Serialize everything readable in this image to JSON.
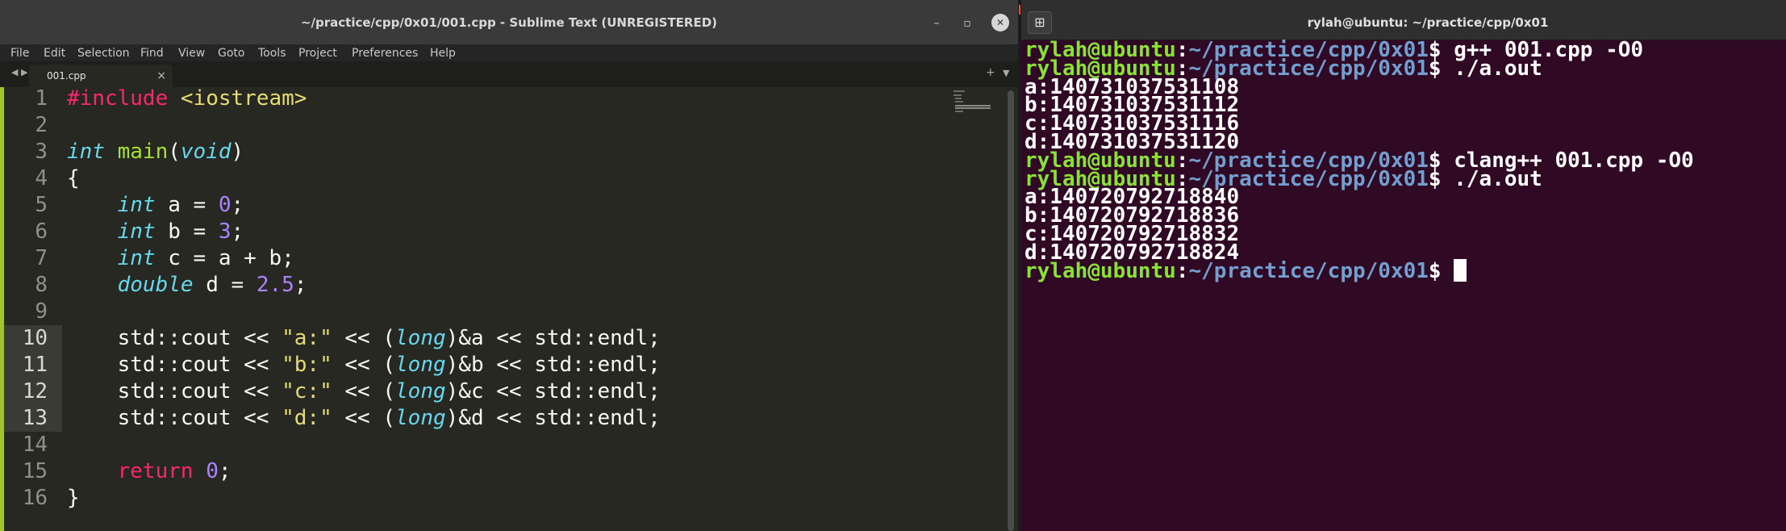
{
  "sublime": {
    "title": "~/practice/cpp/0x01/001.cpp - Sublime Text (UNREGISTERED)",
    "window_buttons": {
      "minimize": "–",
      "maximize": "▫",
      "close": "✕"
    },
    "menu": [
      "File",
      "Edit",
      "Selection",
      "Find",
      "View",
      "Goto",
      "Tools",
      "Project",
      "Preferences",
      "Help"
    ],
    "tab": {
      "label": "001.cpp",
      "close": "×"
    },
    "tab_nav": {
      "left": "◀",
      "right": "▶",
      "add": "+",
      "dropdown": "▼"
    },
    "lines": [
      {
        "n": "1",
        "tokens": [
          [
            "pre",
            "#include"
          ],
          [
            "txt",
            " "
          ],
          [
            "inc",
            "<iostream>"
          ]
        ]
      },
      {
        "n": "2",
        "tokens": []
      },
      {
        "n": "3",
        "tokens": [
          [
            "type",
            "int"
          ],
          [
            "txt",
            " "
          ],
          [
            "fn",
            "main"
          ],
          [
            "txt",
            "("
          ],
          [
            "type",
            "void"
          ],
          [
            "txt",
            ")"
          ]
        ]
      },
      {
        "n": "4",
        "tokens": [
          [
            "txt",
            "{"
          ]
        ]
      },
      {
        "n": "5",
        "tokens": [
          [
            "txt",
            "    "
          ],
          [
            "type",
            "int"
          ],
          [
            "txt",
            " a = "
          ],
          [
            "num",
            "0"
          ],
          [
            "txt",
            ";"
          ]
        ]
      },
      {
        "n": "6",
        "tokens": [
          [
            "txt",
            "    "
          ],
          [
            "type",
            "int"
          ],
          [
            "txt",
            " b = "
          ],
          [
            "num",
            "3"
          ],
          [
            "txt",
            ";"
          ]
        ]
      },
      {
        "n": "7",
        "tokens": [
          [
            "txt",
            "    "
          ],
          [
            "type",
            "int"
          ],
          [
            "txt",
            " c = a + b;"
          ]
        ]
      },
      {
        "n": "8",
        "tokens": [
          [
            "txt",
            "    "
          ],
          [
            "type",
            "double"
          ],
          [
            "txt",
            " d = "
          ],
          [
            "num",
            "2.5"
          ],
          [
            "txt",
            ";"
          ]
        ]
      },
      {
        "n": "9",
        "tokens": []
      },
      {
        "n": "10",
        "tokens": [
          [
            "txt",
            "    std::cout << "
          ],
          [
            "str",
            "\"a:\""
          ],
          [
            "txt",
            " << ("
          ],
          [
            "type",
            "long"
          ],
          [
            "txt",
            ")&a << std::endl;"
          ]
        ],
        "selected": true
      },
      {
        "n": "11",
        "tokens": [
          [
            "txt",
            "    std::cout << "
          ],
          [
            "str",
            "\"b:\""
          ],
          [
            "txt",
            " << ("
          ],
          [
            "type",
            "long"
          ],
          [
            "txt",
            ")&b << std::endl;"
          ]
        ],
        "selected": true
      },
      {
        "n": "12",
        "tokens": [
          [
            "txt",
            "    std::cout << "
          ],
          [
            "str",
            "\"c:\""
          ],
          [
            "txt",
            " << ("
          ],
          [
            "type",
            "long"
          ],
          [
            "txt",
            ")&c << std::endl;"
          ]
        ],
        "selected": true
      },
      {
        "n": "13",
        "tokens": [
          [
            "txt",
            "    std::cout << "
          ],
          [
            "str",
            "\"d:\""
          ],
          [
            "txt",
            " << ("
          ],
          [
            "type",
            "long"
          ],
          [
            "txt",
            ")&d << std::endl;"
          ]
        ],
        "selected": true
      },
      {
        "n": "14",
        "tokens": []
      },
      {
        "n": "15",
        "tokens": [
          [
            "txt",
            "    "
          ],
          [
            "ret",
            "return"
          ],
          [
            "txt",
            " "
          ],
          [
            "num",
            "0"
          ],
          [
            "txt",
            ";"
          ]
        ]
      },
      {
        "n": "16",
        "tokens": [
          [
            "txt",
            "}"
          ]
        ]
      }
    ]
  },
  "terminal": {
    "title": "rylah@ubuntu: ~/practice/cpp/0x01",
    "new_tab_icon": "⊞",
    "prompt_user": "rylah@ubuntu",
    "prompt_sep": ":",
    "prompt_path": "~/practice/cpp/0x01",
    "prompt_end": "$ ",
    "lines": [
      {
        "kind": "prompt",
        "cmd": "g++ 001.cpp -O0"
      },
      {
        "kind": "prompt",
        "cmd": "./a.out"
      },
      {
        "kind": "out",
        "text": "a:140731037531108"
      },
      {
        "kind": "out",
        "text": "b:140731037531112"
      },
      {
        "kind": "out",
        "text": "c:140731037531116"
      },
      {
        "kind": "out",
        "text": "d:140731037531120"
      },
      {
        "kind": "prompt",
        "cmd": "clang++ 001.cpp -O0"
      },
      {
        "kind": "prompt",
        "cmd": "./a.out"
      },
      {
        "kind": "out",
        "text": "a:140720792718840"
      },
      {
        "kind": "out",
        "text": "b:140720792718836"
      },
      {
        "kind": "out",
        "text": "c:140720792718832"
      },
      {
        "kind": "out",
        "text": "d:140720792718824"
      },
      {
        "kind": "prompt",
        "cmd": "",
        "cursor": true
      }
    ]
  }
}
